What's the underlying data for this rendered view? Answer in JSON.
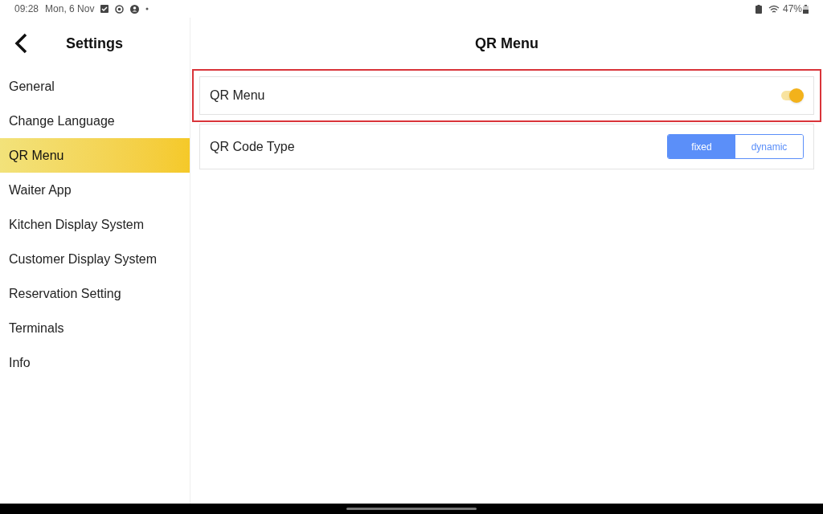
{
  "status_bar": {
    "time": "09:28",
    "date": "Mon, 6 Nov",
    "battery": "47%"
  },
  "sidebar": {
    "title": "Settings",
    "items": [
      {
        "label": "General",
        "selected": false
      },
      {
        "label": "Change Language",
        "selected": false
      },
      {
        "label": "QR Menu",
        "selected": true
      },
      {
        "label": "Waiter App",
        "selected": false
      },
      {
        "label": "Kitchen Display System",
        "selected": false
      },
      {
        "label": "Customer Display System",
        "selected": false
      },
      {
        "label": "Reservation Setting",
        "selected": false
      },
      {
        "label": "Terminals",
        "selected": false
      },
      {
        "label": "Info",
        "selected": false
      }
    ]
  },
  "page": {
    "title": "QR Menu",
    "rows": [
      {
        "kind": "toggle",
        "label": "QR Menu",
        "on": true,
        "highlighted": true
      },
      {
        "kind": "segmented",
        "label": "QR Code Type",
        "options": [
          {
            "label": "fixed",
            "selected": true
          },
          {
            "label": "dynamic",
            "selected": false
          }
        ]
      }
    ]
  }
}
